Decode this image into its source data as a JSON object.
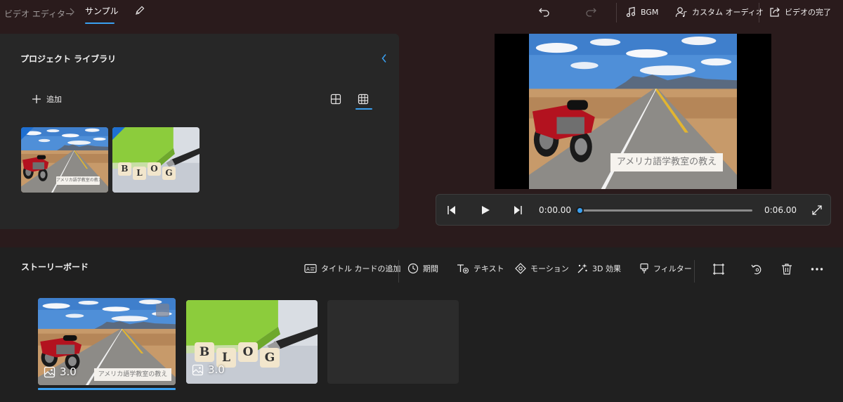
{
  "breadcrumb": {
    "root": "ビデオ エディター",
    "current": "サンプル"
  },
  "toolbar": {
    "bgm": "BGM",
    "custom_audio": "カスタム オーディオ",
    "finish": "ビデオの完了"
  },
  "library": {
    "title": "プロジェクト ライブラリ",
    "add_label": "追加",
    "items": [
      {
        "name": "road-motorcycle",
        "caption": "アメリカ語学教室の教え"
      },
      {
        "name": "blog-dice",
        "letters": [
          "B",
          "L",
          "O",
          "G"
        ]
      }
    ]
  },
  "preview": {
    "caption": "アメリカ語学教室の教え",
    "current_time": "0:00.00",
    "total_time": "0:06.00",
    "progress": 0.0
  },
  "storyboard": {
    "title": "ストーリーボード",
    "tools": {
      "title_card": "タイトル カードの追加",
      "duration": "期間",
      "text": "テキスト",
      "motion": "モーション",
      "effects3d": "3D 効果",
      "filter": "フィルター"
    },
    "cards": [
      {
        "duration": "3.0",
        "caption": "アメリカ語学教室の教え",
        "selected": true
      },
      {
        "duration": "3.0",
        "letters": [
          "B",
          "L",
          "O",
          "G"
        ],
        "selected": false
      }
    ]
  },
  "colors": {
    "accent": "#3aa0f0",
    "app_bg": "#2a1b1c",
    "panel": "#272727",
    "storyboard_bg": "#202020"
  }
}
